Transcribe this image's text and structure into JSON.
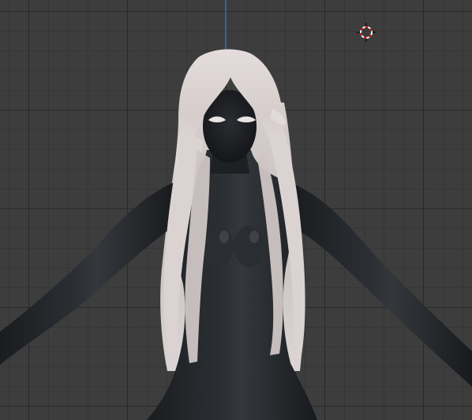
{
  "viewport": {
    "type": "3d-viewport",
    "background_color": "#3d3d3d",
    "grid_line_color": "#2e2e2e",
    "z_axis_color": "#2f6fb5"
  },
  "scene": {
    "object": "character-model",
    "body_material_color": "#202326",
    "hair_color": "#d8d0d0"
  },
  "icons": {
    "cursor": "3d-cursor-icon"
  }
}
